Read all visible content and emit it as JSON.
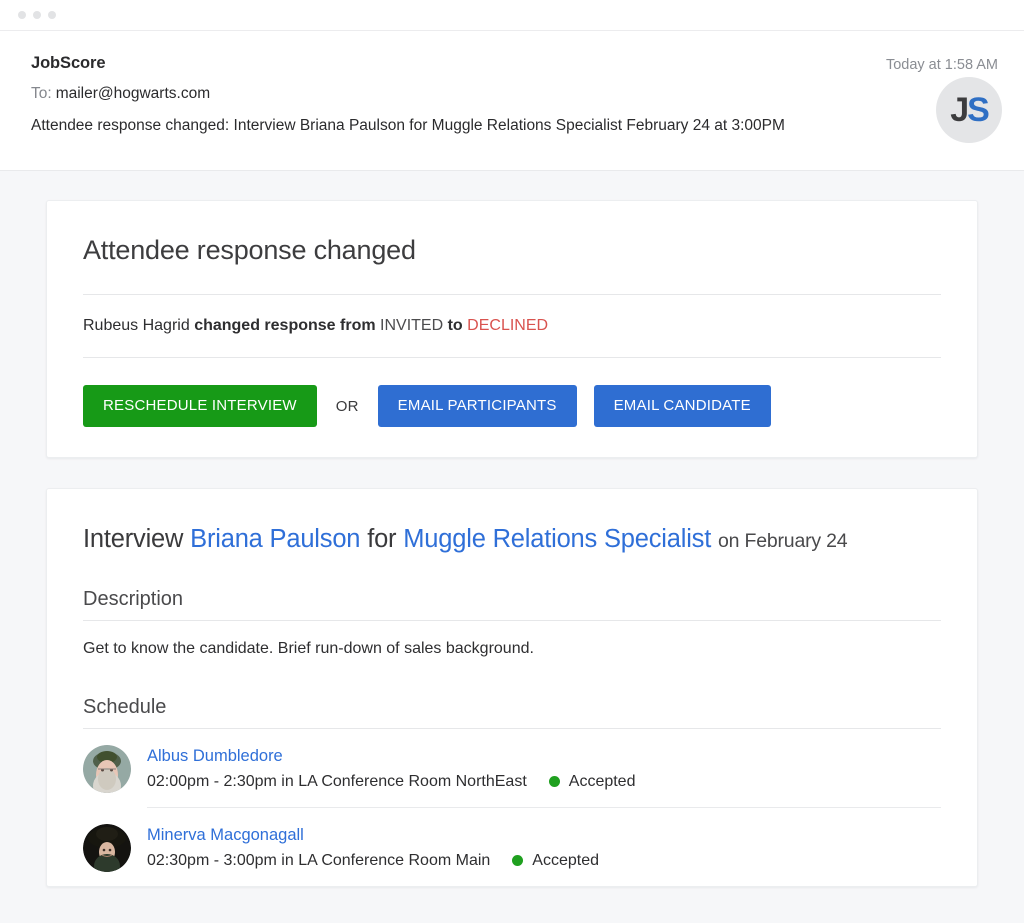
{
  "window": {
    "traffic_lights": [
      "dot-1",
      "dot-2",
      "dot-3"
    ]
  },
  "mail_header": {
    "sender": "JobScore",
    "timestamp": "Today at 1:58 AM",
    "avatar": {
      "icon": "jobscore-avatar",
      "initial_first": "J",
      "initial_second": "S",
      "color_j": "#3c3c3e",
      "color_s": "#2f6fc4",
      "background": "#e4e5e7"
    },
    "to_label": "To:",
    "to_value": "mailer@hogwarts.com",
    "subject": "Attendee response changed: Interview Briana Paulson for Muggle Relations Specialist February 24 at 3:00PM"
  },
  "notice_card": {
    "title": "Attendee response changed",
    "status": {
      "attendee": "Rubeus Hagrid",
      "verb": "changed response from",
      "from_status": "INVITED",
      "to_word": "to",
      "to_status": "DECLINED",
      "declined_color": "#d9534f"
    },
    "actions": {
      "primary_label": "RESCHEDULE INTERVIEW",
      "primary_color": "#179a17",
      "or_label": "OR",
      "secondary_label": "EMAIL PARTICIPANTS",
      "tertiary_label": "EMAIL CANDIDATE",
      "secondary_color": "#2f6ed2"
    }
  },
  "interview_card": {
    "title": {
      "prefix": "Interview",
      "candidate": "Briana Paulson",
      "middle": "for",
      "position": "Muggle Relations Specialist",
      "date_suffix": "on February 24",
      "link_color": "#2f6fd8"
    },
    "description": {
      "heading": "Description",
      "text": "Get to know the candidate. Brief run-down of sales background."
    },
    "schedule": {
      "heading": "Schedule",
      "rows": [
        {
          "avatar": "albus-dumbledore-avatar",
          "name": "Albus Dumbledore",
          "when": "02:00pm - 2:30pm in LA Conference Room NorthEast",
          "status": "Accepted",
          "status_color": "#1fa01f"
        },
        {
          "avatar": "minerva-macgonagall-avatar",
          "name": "Minerva Macgonagall",
          "when": "02:30pm - 3:00pm in LA Conference Room Main",
          "status": "Accepted",
          "status_color": "#1fa01f"
        }
      ]
    }
  }
}
